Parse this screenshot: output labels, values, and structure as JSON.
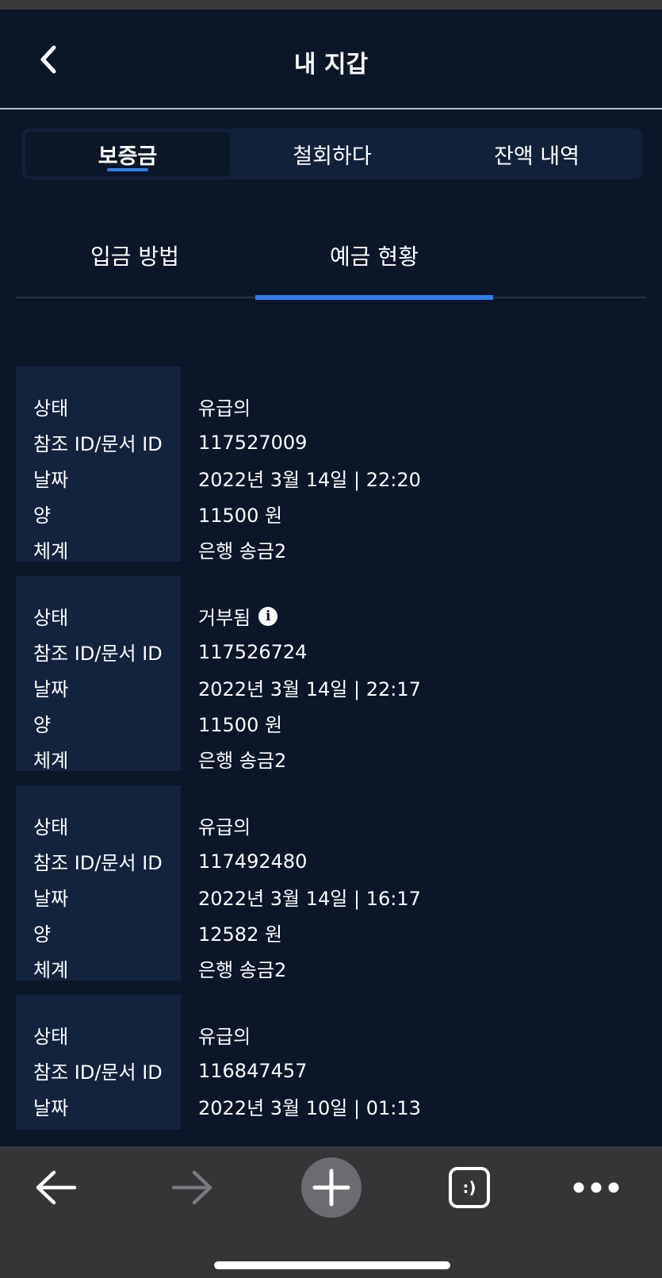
{
  "header": {
    "title": "내 지갑",
    "back_icon": "chevron-left-icon"
  },
  "segments": [
    {
      "label": "보증금",
      "active": true
    },
    {
      "label": "철회하다",
      "active": false
    },
    {
      "label": "잔액 내역",
      "active": false
    }
  ],
  "subtabs": [
    {
      "label": "입금 방법",
      "active": false
    },
    {
      "label": "예금 현황",
      "active": true
    }
  ],
  "field_labels": {
    "status": "상태",
    "ref_id": "참조 ID/문서 ID",
    "date": "날짜",
    "amount": "양",
    "system": "체계"
  },
  "records": [
    {
      "status": "유급의",
      "ref_id": "117527009",
      "date": "2022년 3월 14일 | 22:20",
      "amount": "11500 원",
      "system": "은행 송금2"
    },
    {
      "status": "거부됨",
      "status_icon": "info-icon",
      "ref_id": "117526724",
      "date": "2022년 3월 14일 | 22:17",
      "amount": "11500 원",
      "system": "은행 송금2"
    },
    {
      "status": "유급의",
      "ref_id": "117492480",
      "date": "2022년 3월 14일 | 16:17",
      "amount": "12582 원",
      "system": "은행 송금2"
    },
    {
      "status": "유급의",
      "ref_id": "116847457",
      "date": "2022년 3월 10일 | 01:13",
      "amount": "",
      "system": ""
    }
  ],
  "browser_bar": {
    "back_icon": "arrow-left-icon",
    "forward_icon": "arrow-right-icon",
    "new_tab_icon": "plus-icon",
    "tabs_icon": "tabs-icon",
    "tabs_glyph": ":)",
    "more_icon": "more-dots-icon"
  },
  "colors": {
    "background": "#0b1629",
    "accent": "#2f80ed",
    "label_panel": "#13233e",
    "bar": "#353538"
  }
}
